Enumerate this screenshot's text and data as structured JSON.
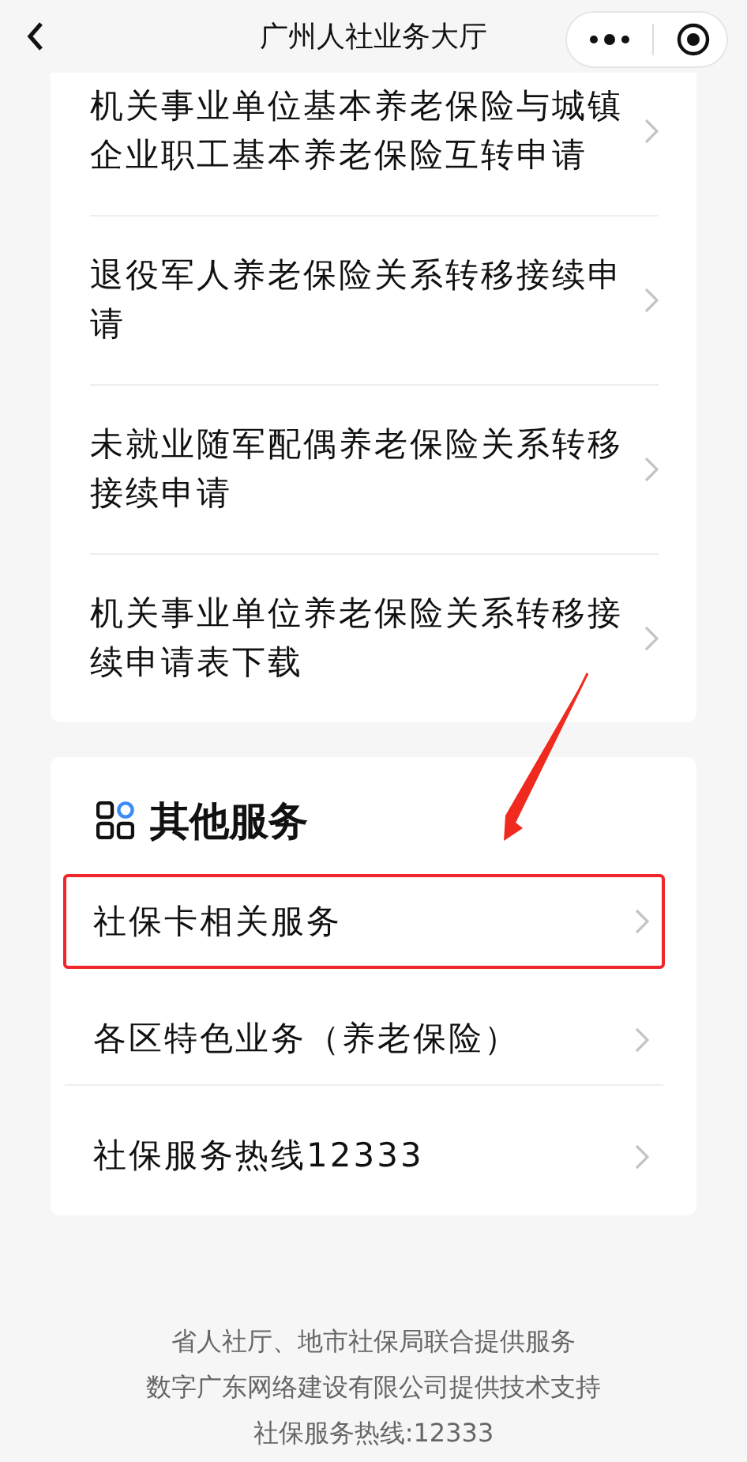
{
  "header": {
    "title": "广州人社业务大厅"
  },
  "transfer_items": [
    {
      "label": "机关事业单位基本养老保险与城镇企业职工基本养老保险互转申请"
    },
    {
      "label": "退役军人养老保险关系转移接续申请"
    },
    {
      "label": "未就业随军配偶养老保险关系转移接续申请"
    },
    {
      "label": "机关事业单位养老保险关系转移接续申请表下载"
    }
  ],
  "other_services": {
    "title": "其他服务",
    "items": [
      {
        "label": "社保卡相关服务",
        "highlighted": true
      },
      {
        "label": "各区特色业务（养老保险）",
        "highlighted": false
      },
      {
        "label": "社保服务热线12333",
        "highlighted": false
      }
    ]
  },
  "footer": [
    "省人社厅、地市社保局联合提供服务",
    "数字广东网络建设有限公司提供技术支持",
    "社保服务热线:12333"
  ]
}
